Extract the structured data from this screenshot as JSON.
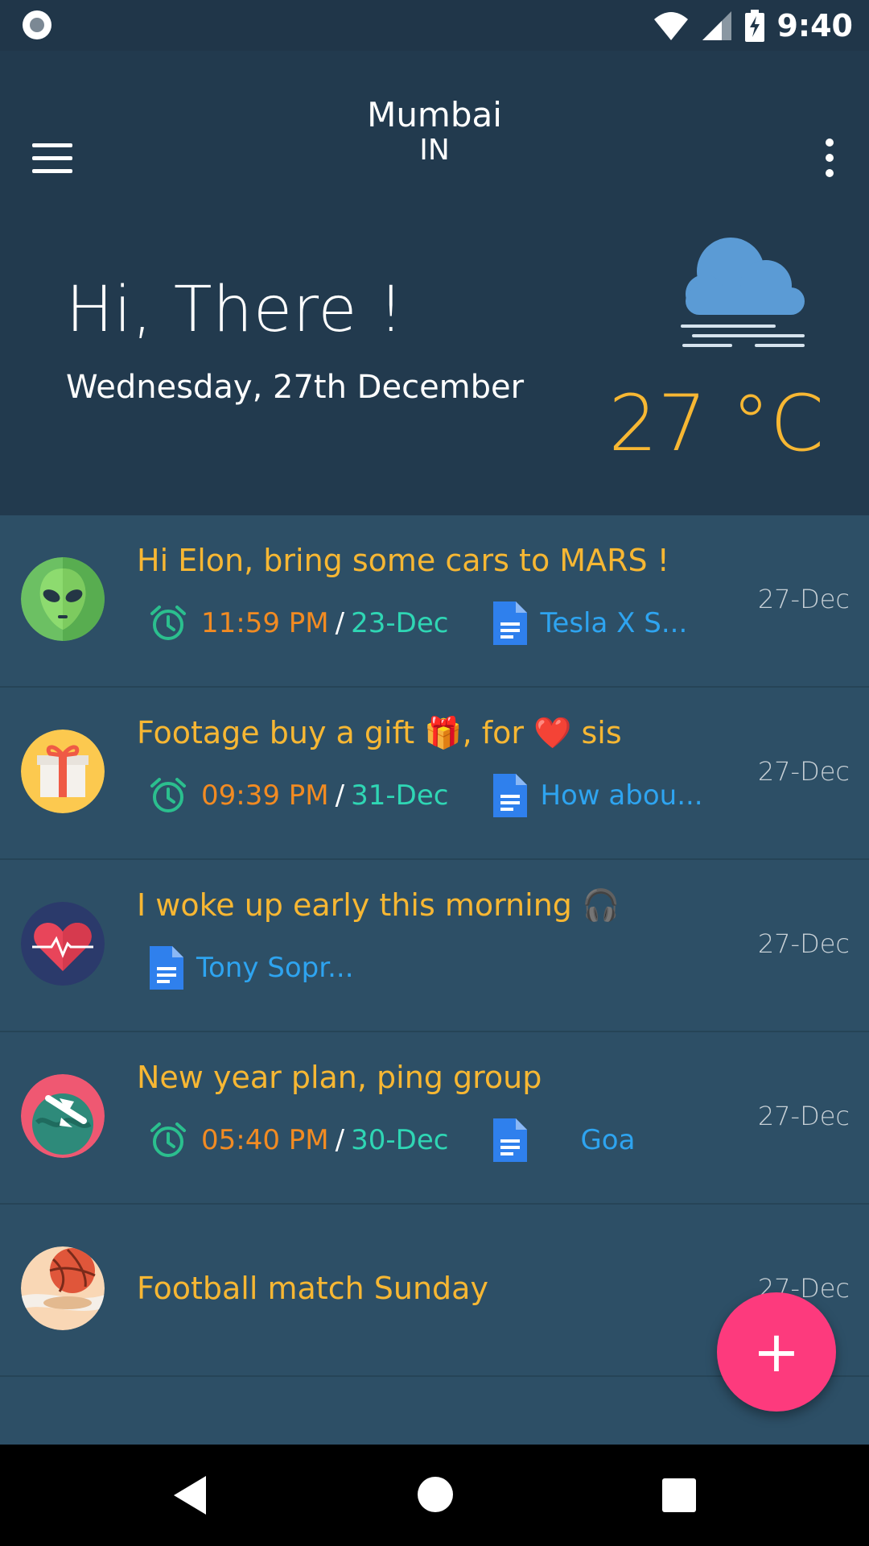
{
  "status_bar": {
    "time": "9:40"
  },
  "header": {
    "city": "Mumbai",
    "country": "IN",
    "greeting": "Hi, There !",
    "date": "Wednesday, 27th December",
    "temperature": "27 °C",
    "weather_icon": "fog-cloud-icon"
  },
  "notes": [
    {
      "avatar": "alien-avatar",
      "title": "Hi Elon, bring some cars to MARS !",
      "reminder_time": "11:59 PM",
      "reminder_date": "23-Dec",
      "attachment": "Tesla  X S...",
      "date": "27-Dec"
    },
    {
      "avatar": "gift-avatar",
      "title": "Footage buy a gift 🎁, for ❤️ sis",
      "reminder_time": "09:39 PM",
      "reminder_date": "31-Dec",
      "attachment": "How abou...",
      "date": "27-Dec"
    },
    {
      "avatar": "heart-avatar",
      "title": "I woke up early this morning 🎧",
      "attachment": "Tony Sopr...",
      "date": "27-Dec"
    },
    {
      "avatar": "travel-avatar",
      "title": "New year plan, ping group",
      "reminder_time": "05:40 PM",
      "reminder_date": "30-Dec",
      "attachment": "Goa",
      "date": "27-Dec"
    },
    {
      "avatar": "ball-avatar",
      "title": "Football match Sunday",
      "date": "27-Dec"
    }
  ],
  "fab": {
    "label": "+"
  },
  "colors": {
    "accent_yellow": "#f7b733",
    "reminder_orange": "#f28b22",
    "due_teal": "#2fd6b4",
    "link_blue": "#2ea4f0",
    "fab_pink": "#fd3a7d"
  }
}
